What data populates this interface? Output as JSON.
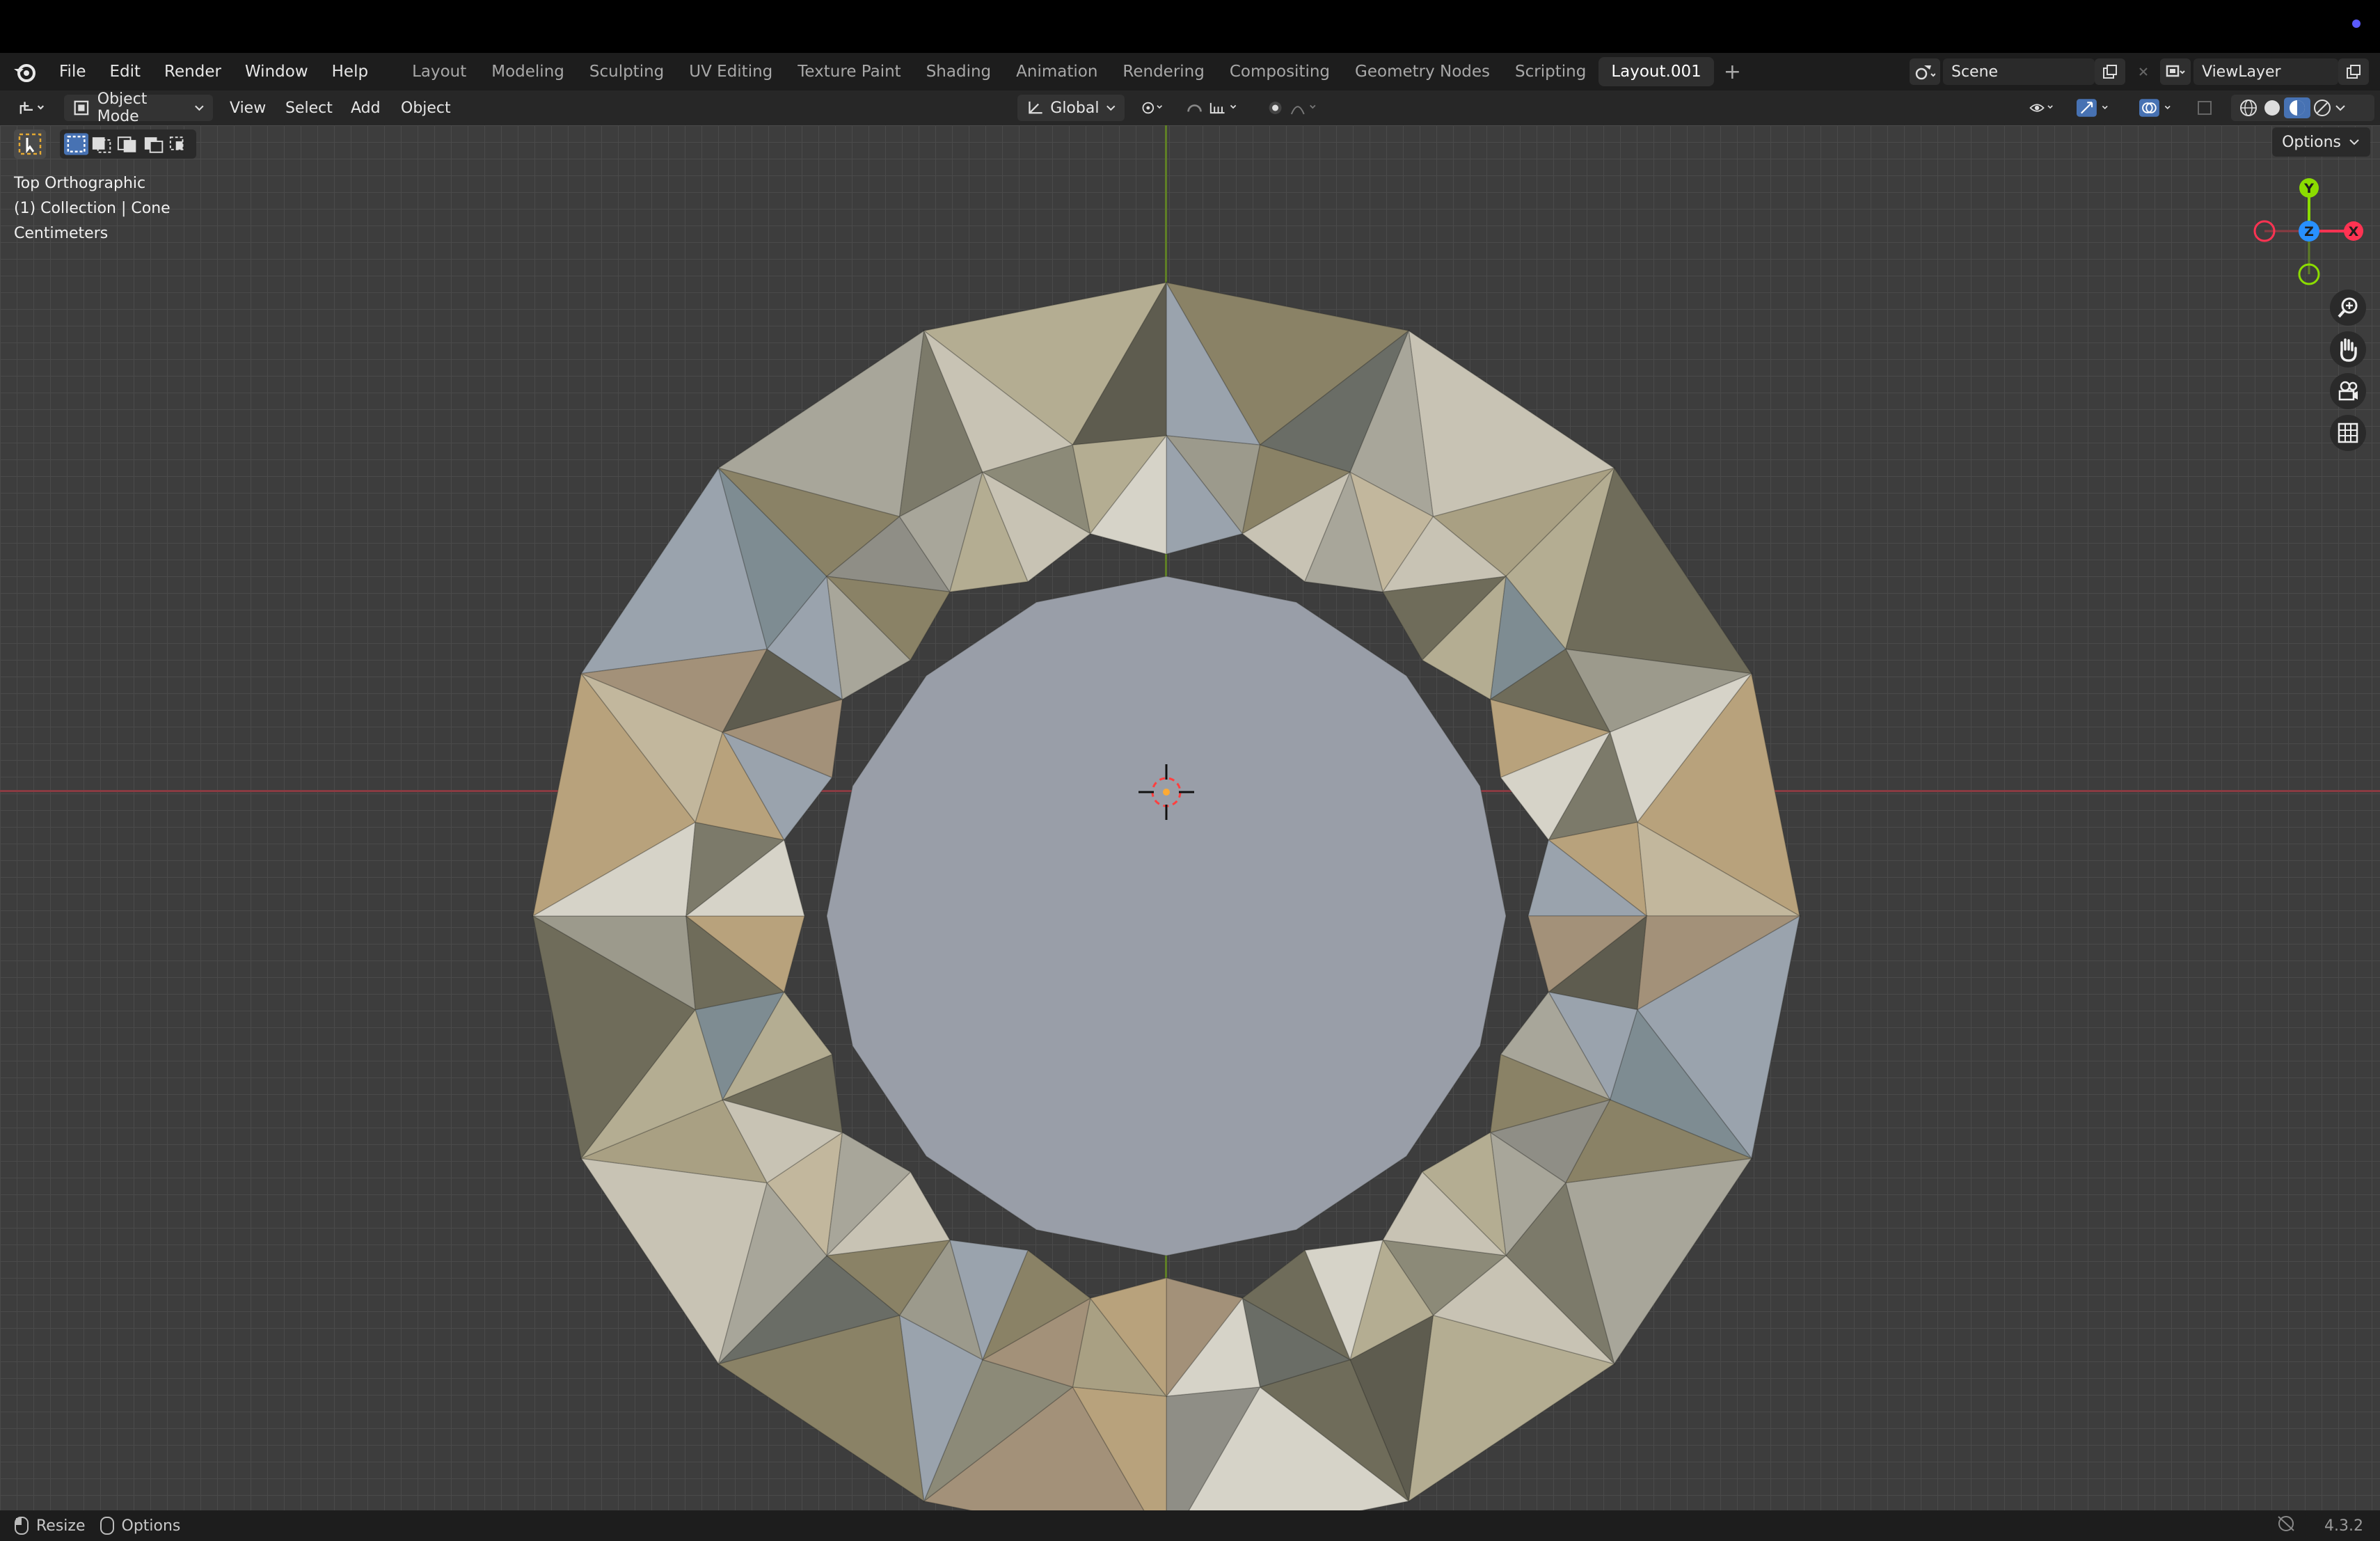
{
  "menubar": {
    "items": [
      "File",
      "Edit",
      "Render",
      "Window",
      "Help"
    ]
  },
  "workspaces": [
    "Layout",
    "Modeling",
    "Sculpting",
    "UV Editing",
    "Texture Paint",
    "Shading",
    "Animation",
    "Rendering",
    "Compositing",
    "Geometry Nodes",
    "Scripting",
    "Layout.001"
  ],
  "active_workspace": "Layout.001",
  "scene": {
    "name": "Scene",
    "view_layer": "ViewLayer"
  },
  "header": {
    "mode": "Object Mode",
    "menus": [
      "View",
      "Select",
      "Add",
      "Object"
    ],
    "orientation": "Global",
    "options": "Options"
  },
  "overlay_info": {
    "view": "Top Orthographic",
    "collection": "(1) Collection | Cone",
    "units": "Centimeters"
  },
  "gizmo": {
    "y": "Y",
    "x": "X",
    "z": "Z"
  },
  "statusbar": {
    "resize": "Resize",
    "options": "Options",
    "version": "4.3.2"
  },
  "colors": {
    "accent": "#4772b3",
    "x_axis": "#ff3352",
    "y_axis": "#8bdc00",
    "z_axis": "#2890ff"
  },
  "icons": [
    "blender-logo",
    "editor-type-icon",
    "object-mode-icon",
    "transform-orientation-icon",
    "pivot-icon",
    "snap-icon",
    "proportional-edit-icon",
    "visibility-icon",
    "gizmo-icon",
    "overlay-icon",
    "wireframe-shading-icon",
    "solid-shading-icon",
    "material-shading-icon",
    "rendered-shading-icon",
    "zoom-icon",
    "hand-pan-icon",
    "camera-icon",
    "grid-icon",
    "select-box-icon",
    "mouse-icon"
  ]
}
